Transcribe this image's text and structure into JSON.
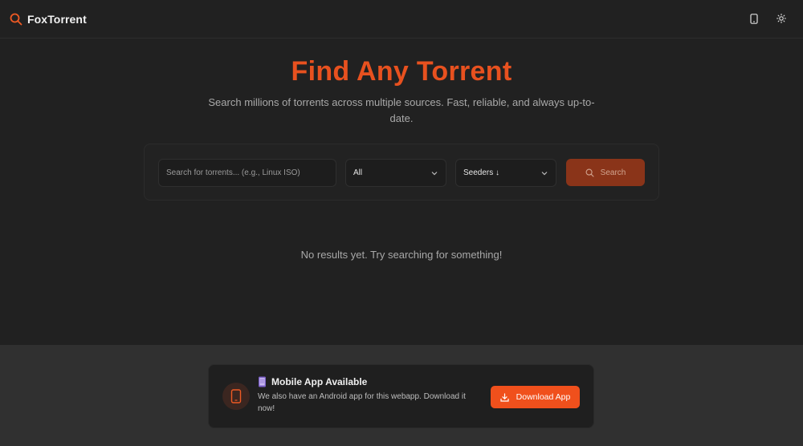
{
  "header": {
    "brand_name": "FoxTorrent",
    "brand_icon": "search-icon",
    "actions": [
      {
        "name": "mobile-app-icon"
      },
      {
        "name": "theme-toggle-sun-icon"
      }
    ]
  },
  "hero": {
    "title": "Find Any Torrent",
    "subtitle": "Search millions of torrents across multiple sources. Fast, reliable, and always up-to-date."
  },
  "search": {
    "placeholder": "Search for torrents... (e.g., Linux ISO)",
    "value": "",
    "category_selected": "All",
    "sort_selected": "Seeders ↓",
    "button_label": "Search"
  },
  "results": {
    "empty_message": "No results yet. Try searching for something!"
  },
  "footer": {
    "app_title": "Mobile App Available",
    "app_description": "We also have an Android app for this webapp. Download it now!",
    "download_label": "Download App"
  },
  "colors": {
    "accent": "#f0501c",
    "title": "#e8511f",
    "search_button": "#8a3419",
    "background": "#212121",
    "footer_bg": "#303030"
  }
}
